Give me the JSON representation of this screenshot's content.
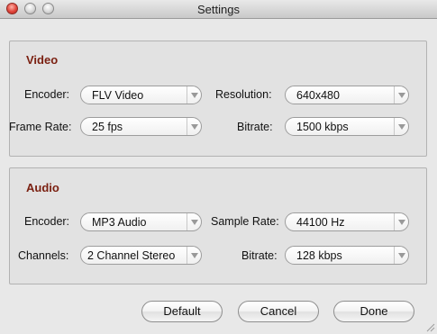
{
  "window": {
    "title": "Settings"
  },
  "video": {
    "heading": "Video",
    "encoder": {
      "label": "Encoder:",
      "value": "FLV Video"
    },
    "resolution": {
      "label": "Resolution:",
      "value": "640x480"
    },
    "frame_rate": {
      "label": "Frame Rate:",
      "value": "25 fps"
    },
    "bitrate": {
      "label": "Bitrate:",
      "value": "1500 kbps"
    }
  },
  "audio": {
    "heading": "Audio",
    "encoder": {
      "label": "Encoder:",
      "value": "MP3 Audio"
    },
    "sample_rate": {
      "label": "Sample Rate:",
      "value": "44100 Hz"
    },
    "channels": {
      "label": "Channels:",
      "value": "2 Channel Stereo"
    },
    "bitrate": {
      "label": "Bitrate:",
      "value": "128 kbps"
    }
  },
  "buttons": {
    "default": "Default",
    "cancel": "Cancel",
    "done": "Done"
  },
  "icons": {
    "close": "close-icon",
    "minimize": "minimize-icon",
    "zoom": "zoom-icon",
    "dropdown": "chevron-down-icon",
    "resize": "resize-grip-icon"
  },
  "colors": {
    "section_heading": "#7a1f10",
    "close_button": "#e0443a"
  }
}
